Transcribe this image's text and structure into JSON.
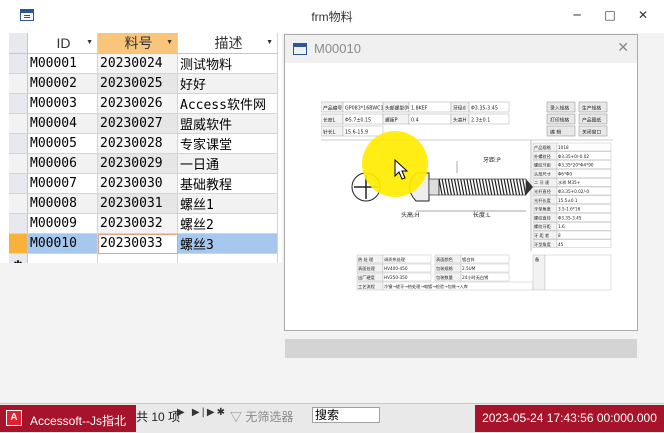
{
  "window": {
    "title": "frm物料",
    "controls": [
      "─",
      "□",
      "✕"
    ]
  },
  "table": {
    "columns": [
      {
        "label": "ID",
        "has_dropdown": true
      },
      {
        "label": "料号",
        "has_dropdown": true
      },
      {
        "label": "描述",
        "has_dropdown": true
      }
    ],
    "rows": [
      [
        "M00001",
        "20230024",
        "测试物料"
      ],
      [
        "M00002",
        "20230025",
        "好好"
      ],
      [
        "M00003",
        "20230026",
        "Access软件网"
      ],
      [
        "M00004",
        "20230027",
        "盟威软件"
      ],
      [
        "M00005",
        "20230028",
        "专家课堂"
      ],
      [
        "M00006",
        "20230029",
        "一日通"
      ],
      [
        "M00007",
        "20230030",
        "基础教程"
      ],
      [
        "M00008",
        "20230031",
        "螺丝1"
      ],
      [
        "M00009",
        "20230032",
        "螺丝2"
      ],
      [
        "M00010",
        "20230033",
        "螺丝3"
      ]
    ],
    "current_row": 9,
    "new_row_marker": "✱"
  },
  "popup": {
    "title": "M00010",
    "close": "✕"
  },
  "drawing": {
    "header_labels": [
      "产品编号",
      "GP083*16BWC18",
      "头部螺型(M)",
      "1.8KEF",
      "牙径d",
      "Φ3.35-3.45",
      "长度L",
      "Φ5.7±0.15",
      "螺距P",
      "0.4",
      "头高H",
      "2.3±0.1",
      "针长L",
      "15.6-15.9"
    ],
    "buttons": [
      "录入规格",
      "生产规格",
      "打印规格",
      "产品图纸",
      "编 辑",
      "关闭窗口"
    ],
    "dims": [
      "牙距:P",
      "头高:H",
      "长度:L"
    ],
    "spec_labels": [
      "产品规格",
      "外螺纹径",
      "螺纹牙距",
      "头部尺寸",
      "二 牙 规",
      "光杆直径",
      "光杆长度",
      "牙型角度",
      "螺纹直径",
      "螺纹牙距",
      "牙 距 差",
      "牙型角度"
    ],
    "spec_values": [
      "1018",
      "Φ3.35+0/-0.02",
      "Φ3.35*20*Φ4*90",
      "Φ6*Φ0",
      "水样 M35+",
      "Φ3.35+0.02/-0",
      "15.5±0.1",
      "3.5-1.6*16",
      "Φ3.35-3.45",
      "1.6",
      "8",
      "45"
    ],
    "bottom_labels": [
      "热 处 理",
      "表面处理",
      "出厂硬度",
      "工艺流程",
      "表面颜色",
      "包装规格",
      "包装数量"
    ],
    "bottom_values": [
      "调质热处理",
      "HV400-450",
      "HV250-350",
      "冷镦→搓牙→热处理→电镀→检验→包装→入库",
      "镀白锌",
      "2.5UM",
      "24小时无白锈"
    ],
    "note_label": "备"
  },
  "navigation": {
    "taskbar_label": "Accessoft--Js指北",
    "record_of": "共 10 项",
    "no_filter": "无筛选器",
    "search_placeholder": "搜索",
    "clock": "2023-05-24 17:43:56 00:000.000"
  }
}
